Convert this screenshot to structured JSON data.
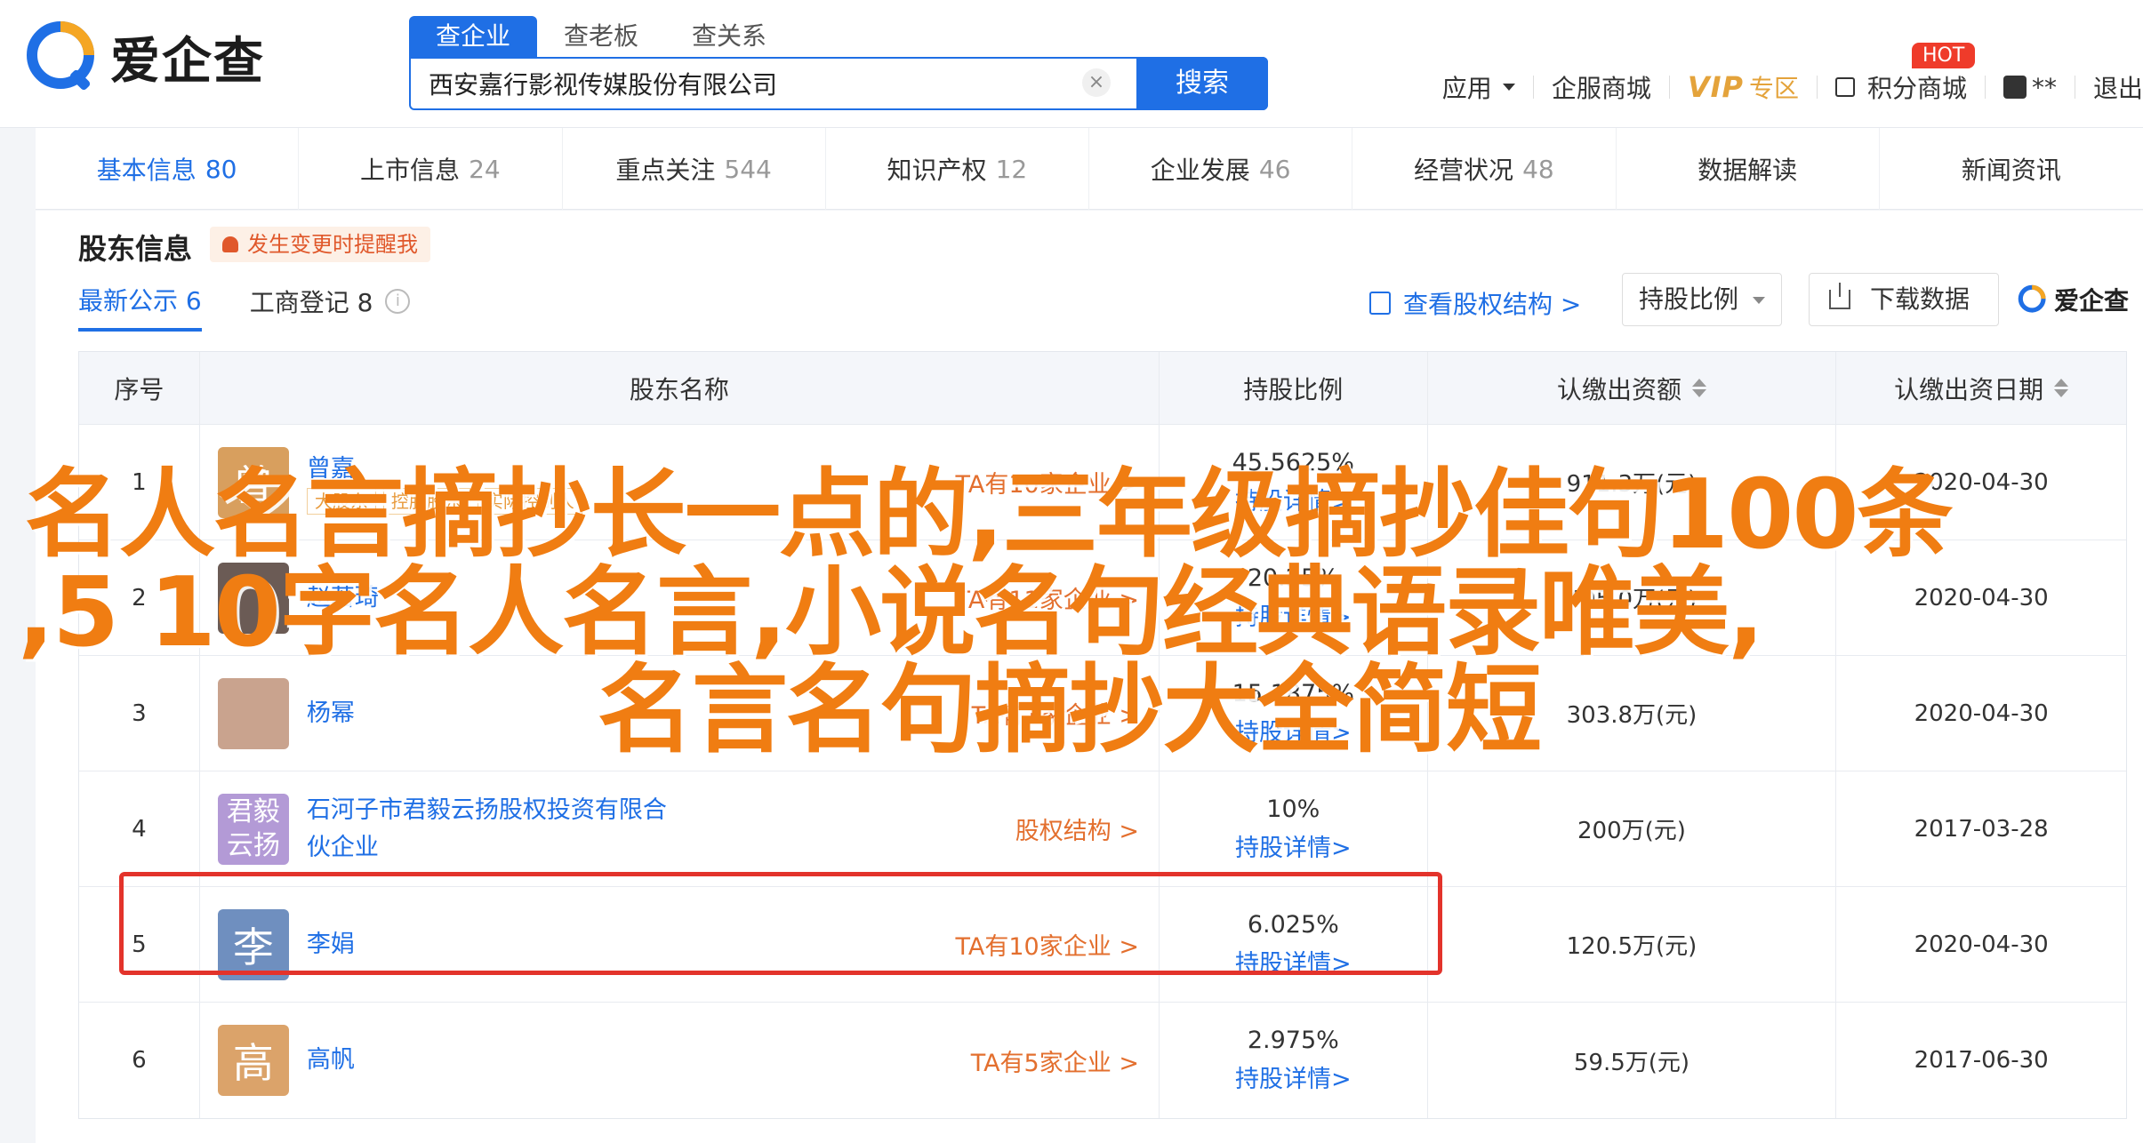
{
  "brand": {
    "logo_text": "爱企查"
  },
  "search": {
    "tabs": [
      "查企业",
      "查老板",
      "查关系"
    ],
    "value": "西安嘉行影视传媒股份有限公司",
    "clear": "×",
    "button": "搜索"
  },
  "topnav": {
    "apps": "应用",
    "mall": "企服商城",
    "vip": "VIP",
    "vip_sub": "专区",
    "points": "积分商城",
    "hot": "HOT",
    "user": "**",
    "logout": "退出"
  },
  "module_tabs": [
    {
      "label": "基本信息",
      "count": "80"
    },
    {
      "label": "上市信息",
      "count": "24"
    },
    {
      "label": "重点关注",
      "count": "544"
    },
    {
      "label": "知识产权",
      "count": "12"
    },
    {
      "label": "企业发展",
      "count": "46"
    },
    {
      "label": "经营状况",
      "count": "48"
    },
    {
      "label": "数据解读",
      "count": ""
    },
    {
      "label": "新闻资讯",
      "count": ""
    }
  ],
  "section": {
    "title": "股东信息",
    "remind": "发生变更时提醒我",
    "subtabs": [
      "最新公示 6",
      "工商登记 8"
    ],
    "view_structure": "查看股权结构 >",
    "ratio_select": "持股比例",
    "download": "下载数据",
    "mini_logo": "爱企查"
  },
  "table": {
    "headers": [
      "序号",
      "股东名称",
      "持股比例",
      "认缴出资额",
      "认缴出资日期"
    ],
    "rows": [
      {
        "no": "1",
        "name": "曾嘉",
        "tags": [
          "大股东",
          "控股股东",
          "实际控制人"
        ],
        "assoc": "TA有10家企业 >",
        "pct": "45.5625%",
        "detail": "持股详情>",
        "amount": "911.3万(元)",
        "date": "2020-04-30",
        "avatar": "曾",
        "avatar_color": "#d89f5e"
      },
      {
        "no": "2",
        "name": "赵若琦",
        "tags": [],
        "assoc": "TA有11家企业 >",
        "pct": "20.25%",
        "detail": "持股详情>",
        "amount": "405.0万(元)",
        "date": "2020-04-30",
        "avatar": "",
        "avatar_color": "#6b5b55"
      },
      {
        "no": "3",
        "name": "杨幂",
        "tags": [],
        "assoc": "TA有1家企业 >",
        "pct": "15.1875%",
        "detail": "持股详情>",
        "amount": "303.8万(元)",
        "date": "2020-04-30",
        "avatar": "",
        "avatar_color": "#c9a38e"
      },
      {
        "no": "4",
        "name": "石河子市君毅云扬股权投资有限合伙企业",
        "tags": [],
        "assoc": "股权结构 >",
        "pct": "10%",
        "detail": "持股详情>",
        "amount": "200万(元)",
        "date": "2017-03-28",
        "avatar": "君毅云扬",
        "avatar_color": "#b39ad6"
      },
      {
        "no": "5",
        "name": "李娟",
        "tags": [],
        "assoc": "TA有10家企业 >",
        "pct": "6.025%",
        "detail": "持股详情>",
        "amount": "120.5万(元)",
        "date": "2020-04-30",
        "avatar": "李",
        "avatar_color": "#6f8fbf"
      },
      {
        "no": "6",
        "name": "高帆",
        "tags": [],
        "assoc": "TA有5家企业 >",
        "pct": "2.975%",
        "detail": "持股详情>",
        "amount": "59.5万(元)",
        "date": "2017-06-30",
        "avatar": "高",
        "avatar_color": "#dba36a"
      }
    ]
  },
  "caption": {
    "line1": "名人名言摘抄长一点的,三年级摘抄佳句100条",
    "line2": ",5 10字名人名言,小说名句经典语录唯美,",
    "line3": "名言名句摘抄大全简短"
  },
  "colors": {
    "accent": "#1f6fe5",
    "warning": "#e3332b",
    "caption": "#f07d12"
  }
}
